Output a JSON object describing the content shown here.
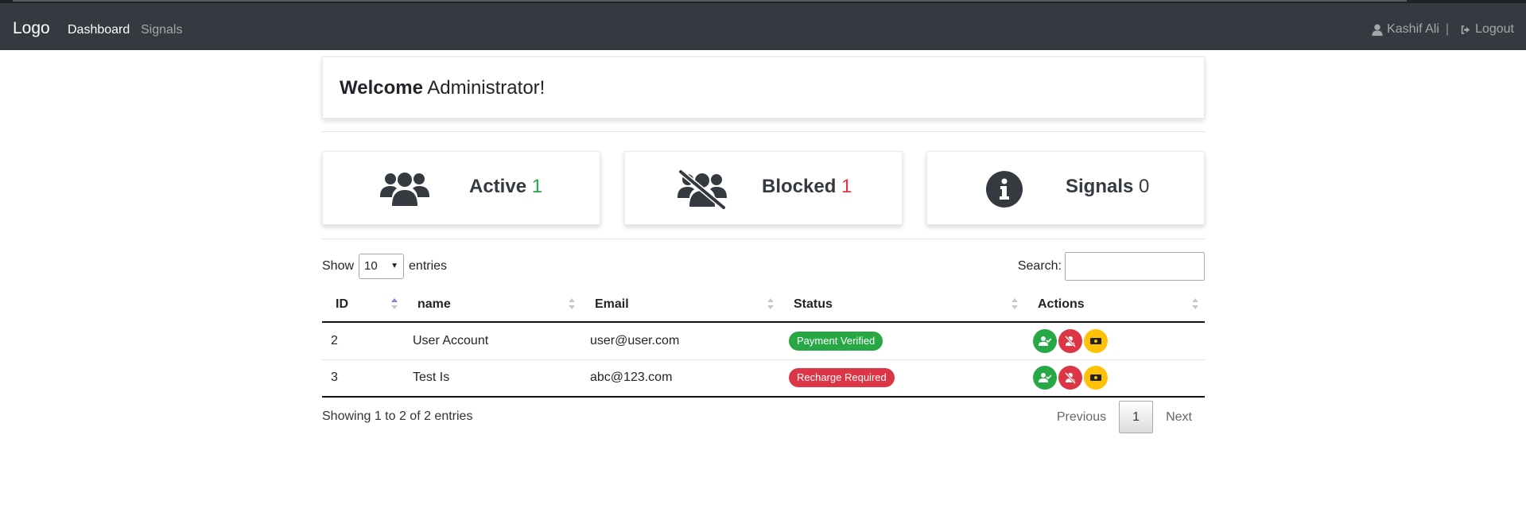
{
  "navbar": {
    "brand": "Logo",
    "links": [
      {
        "label": "Dashboard",
        "active": true
      },
      {
        "label": "Signals",
        "active": false
      }
    ],
    "user_name": "Kashif Ali",
    "separator": "|",
    "logout_label": "Logout",
    "icons": {
      "user": "user-icon",
      "logout": "sign-out-icon"
    }
  },
  "welcome": {
    "bold": "Welcome",
    "rest": "Administrator!"
  },
  "stats": [
    {
      "label": "Active",
      "value": "1",
      "icon": "users-icon",
      "value_color": "#28a745"
    },
    {
      "label": "Blocked",
      "value": "1",
      "icon": "users-slash-icon",
      "value_color": "#dc3545"
    },
    {
      "label": "Signals",
      "value": "0",
      "icon": "info-circle-icon",
      "value_color": "#343a40"
    }
  ],
  "table_controls": {
    "show_label": "Show",
    "entries_value": "10",
    "entries_label": "entries",
    "search_label": "Search:",
    "search_value": ""
  },
  "table": {
    "columns": [
      "ID",
      "name",
      "Email",
      "Status",
      "Actions"
    ],
    "sorted_column": "ID",
    "rows": [
      {
        "id": "2",
        "name": "User Account",
        "email": "user@user.com",
        "status": "Payment Verified",
        "status_color": "green",
        "actions": [
          "user-check-icon",
          "user-slash-icon",
          "money-bill-icon"
        ]
      },
      {
        "id": "3",
        "name": "Test Is",
        "email": "abc@123.com",
        "status": "Recharge Required",
        "status_color": "red",
        "actions": [
          "user-check-icon",
          "user-slash-icon",
          "money-bill-icon"
        ]
      }
    ]
  },
  "footer": {
    "info": "Showing 1 to 2 of 2 entries",
    "previous_label": "Previous",
    "current_page": "1",
    "next_label": "Next"
  },
  "colors": {
    "navbar_bg": "#343a40",
    "success": "#28a745",
    "danger": "#dc3545",
    "warning": "#ffc107"
  }
}
